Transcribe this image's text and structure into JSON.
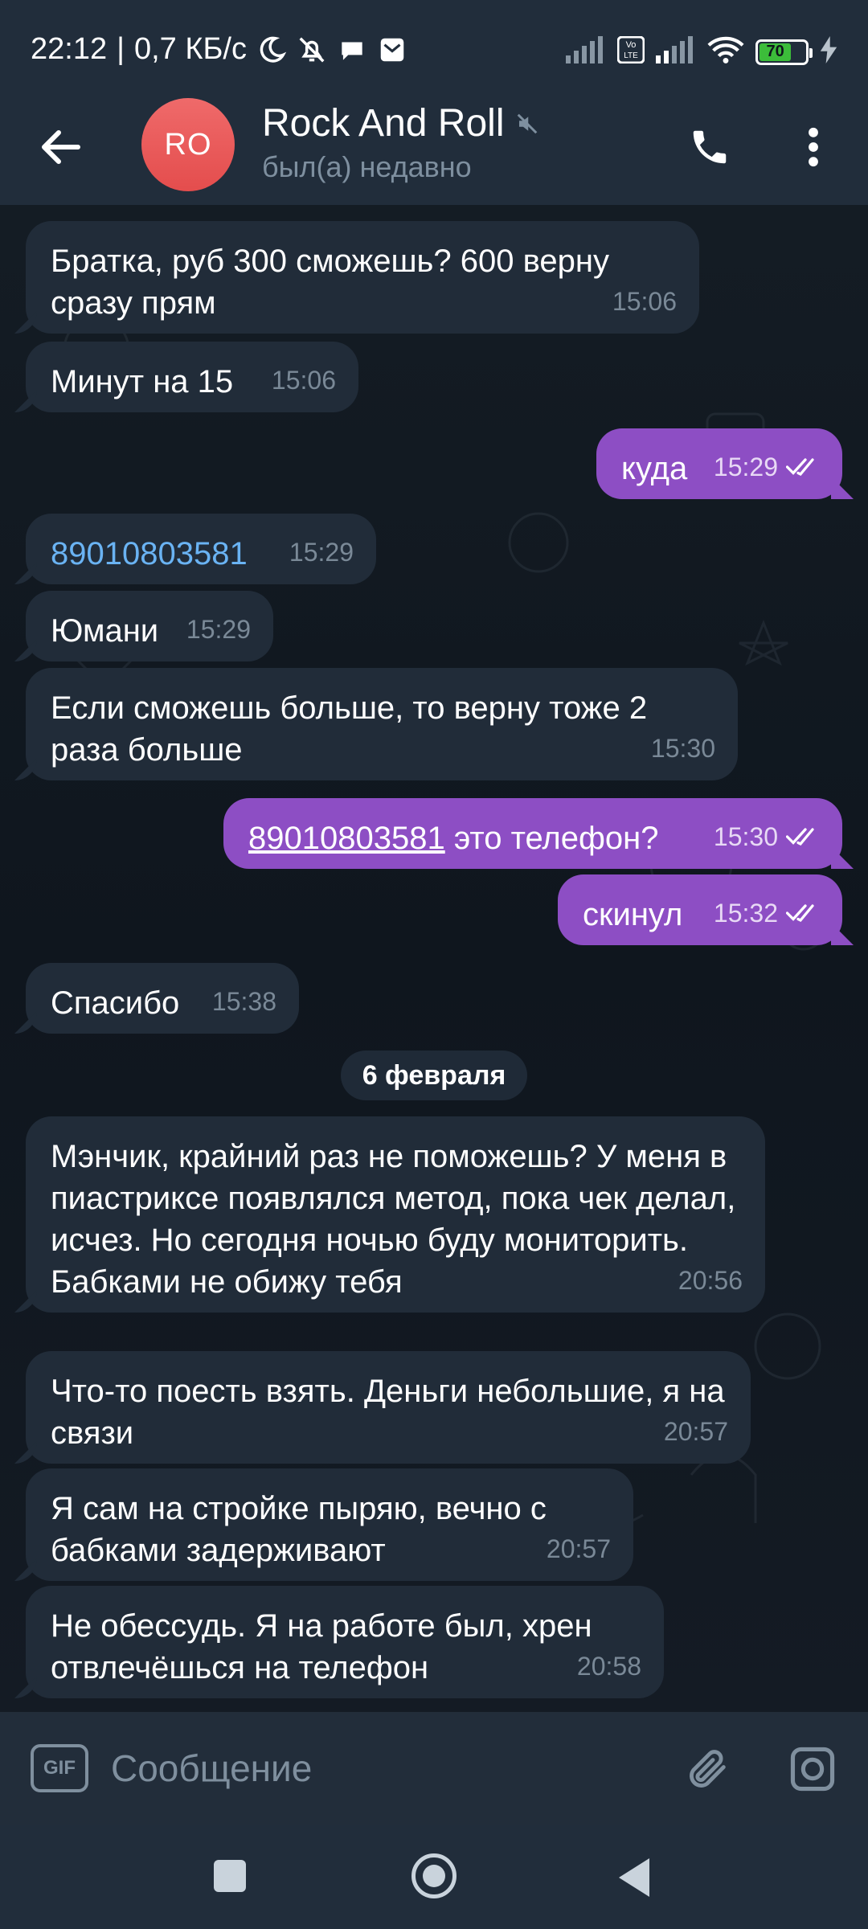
{
  "status_bar": {
    "time": "22:12",
    "separator": "|",
    "network_speed": "0,7 КБ/с",
    "battery_level": "70",
    "volte_label": "Vo LTE"
  },
  "header": {
    "avatar_initials": "RO",
    "title": "Rock And Roll",
    "status": "был(а) недавно",
    "muted": true,
    "avatar_color": "#e85a5a"
  },
  "messages": [
    {
      "direction": "in",
      "text": "Братка, руб 300 сможешь? 600 верну сразу прям",
      "time": "15:06"
    },
    {
      "direction": "in",
      "text": "Минут на 15",
      "time": "15:06"
    },
    {
      "direction": "out",
      "text": "куда",
      "time": "15:29",
      "read": true
    },
    {
      "direction": "in",
      "text": "89010803581",
      "time": "15:29"
    },
    {
      "direction": "in",
      "text": "Юмани",
      "time": "15:29"
    },
    {
      "direction": "in",
      "text": "Если сможешь больше, то верну тоже 2 раза больше",
      "time": "15:30"
    },
    {
      "direction": "out",
      "link": "89010803581",
      "text": " это телефон?",
      "time": "15:30",
      "read": true
    },
    {
      "direction": "out",
      "text": "скинул",
      "time": "15:32",
      "read": true
    },
    {
      "direction": "in",
      "text": "Спасибо",
      "time": "15:38"
    },
    {
      "direction": "in",
      "text": "Мэнчик, крайний раз не поможешь? У меня в пиастриксе появлялся метод, пока чек делал, исчез. Но сегодня ночью буду мониторить. Бабками не обижу тебя",
      "time": "20:56"
    },
    {
      "direction": "in",
      "text": "Что-то поесть взять. Деньги небольшие, я на связи",
      "time": "20:57"
    },
    {
      "direction": "in",
      "text": "Я сам на стройке пыряю, вечно с бабками задерживают",
      "time": "20:57"
    },
    {
      "direction": "in",
      "text": "Не обессудь. Я на работе был, хрен отвлечёшься на телефон",
      "time": "20:58"
    }
  ],
  "date_separator": "6 февраля",
  "composer": {
    "gif_label": "GIF",
    "placeholder": "Сообщение"
  },
  "colors": {
    "incoming_bubble": "#212c39",
    "outgoing_bubble": "#8d4ec4",
    "link": "#6ab3f3",
    "header_bg": "#212d3b"
  }
}
